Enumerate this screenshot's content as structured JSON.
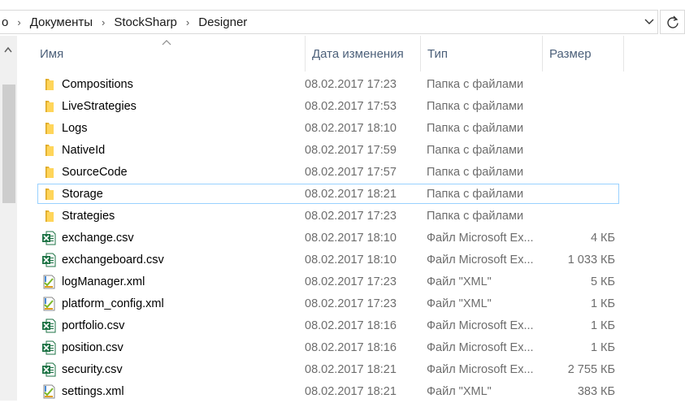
{
  "breadcrumb": {
    "leading_fragment": "о",
    "parts": [
      "Документы",
      "StockSharp",
      "Designer"
    ]
  },
  "columns": {
    "name": "Имя",
    "date": "Дата изменения",
    "type": "Тип",
    "size": "Размер"
  },
  "files": [
    {
      "name": "Compositions",
      "date": "08.02.2017 17:23",
      "type": "Папка с файлами",
      "size": "",
      "icon": "folder-icon"
    },
    {
      "name": "LiveStrategies",
      "date": "08.02.2017 17:53",
      "type": "Папка с файлами",
      "size": "",
      "icon": "folder-icon"
    },
    {
      "name": "Logs",
      "date": "08.02.2017 18:10",
      "type": "Папка с файлами",
      "size": "",
      "icon": "folder-icon"
    },
    {
      "name": "NativeId",
      "date": "08.02.2017 17:59",
      "type": "Папка с файлами",
      "size": "",
      "icon": "folder-icon"
    },
    {
      "name": "SourceCode",
      "date": "08.02.2017 17:57",
      "type": "Папка с файлами",
      "size": "",
      "icon": "folder-icon"
    },
    {
      "name": "Storage",
      "date": "08.02.2017 18:21",
      "type": "Папка с файлами",
      "size": "",
      "icon": "folder-icon",
      "selected": true
    },
    {
      "name": "Strategies",
      "date": "08.02.2017 17:23",
      "type": "Папка с файлами",
      "size": "",
      "icon": "folder-icon"
    },
    {
      "name": "exchange.csv",
      "date": "08.02.2017 18:10",
      "type": "Файл Microsoft Ex...",
      "size": "4 КБ",
      "icon": "excel-file-icon"
    },
    {
      "name": "exchangeboard.csv",
      "date": "08.02.2017 18:10",
      "type": "Файл Microsoft Ex...",
      "size": "1 033 КБ",
      "icon": "excel-file-icon"
    },
    {
      "name": "logManager.xml",
      "date": "08.02.2017 17:23",
      "type": "Файл \"XML\"",
      "size": "5 КБ",
      "icon": "xml-file-icon"
    },
    {
      "name": "platform_config.xml",
      "date": "08.02.2017 17:23",
      "type": "Файл \"XML\"",
      "size": "1 КБ",
      "icon": "xml-file-icon"
    },
    {
      "name": "portfolio.csv",
      "date": "08.02.2017 18:16",
      "type": "Файл Microsoft Ex...",
      "size": "1 КБ",
      "icon": "excel-file-icon"
    },
    {
      "name": "position.csv",
      "date": "08.02.2017 18:16",
      "type": "Файл Microsoft Ex...",
      "size": "1 КБ",
      "icon": "excel-file-icon"
    },
    {
      "name": "security.csv",
      "date": "08.02.2017 18:21",
      "type": "Файл Microsoft Ex...",
      "size": "2 755 КБ",
      "icon": "excel-file-icon"
    },
    {
      "name": "settings.xml",
      "date": "08.02.2017 18:21",
      "type": "Файл \"XML\"",
      "size": "383 КБ",
      "icon": "xml-file-icon"
    }
  ],
  "colors": {
    "folder": "#ffd55a",
    "excel": "#1d7345",
    "xml_accent": "#7bb829",
    "selection_border": "#99d1ff",
    "header_text": "#4c607a"
  }
}
